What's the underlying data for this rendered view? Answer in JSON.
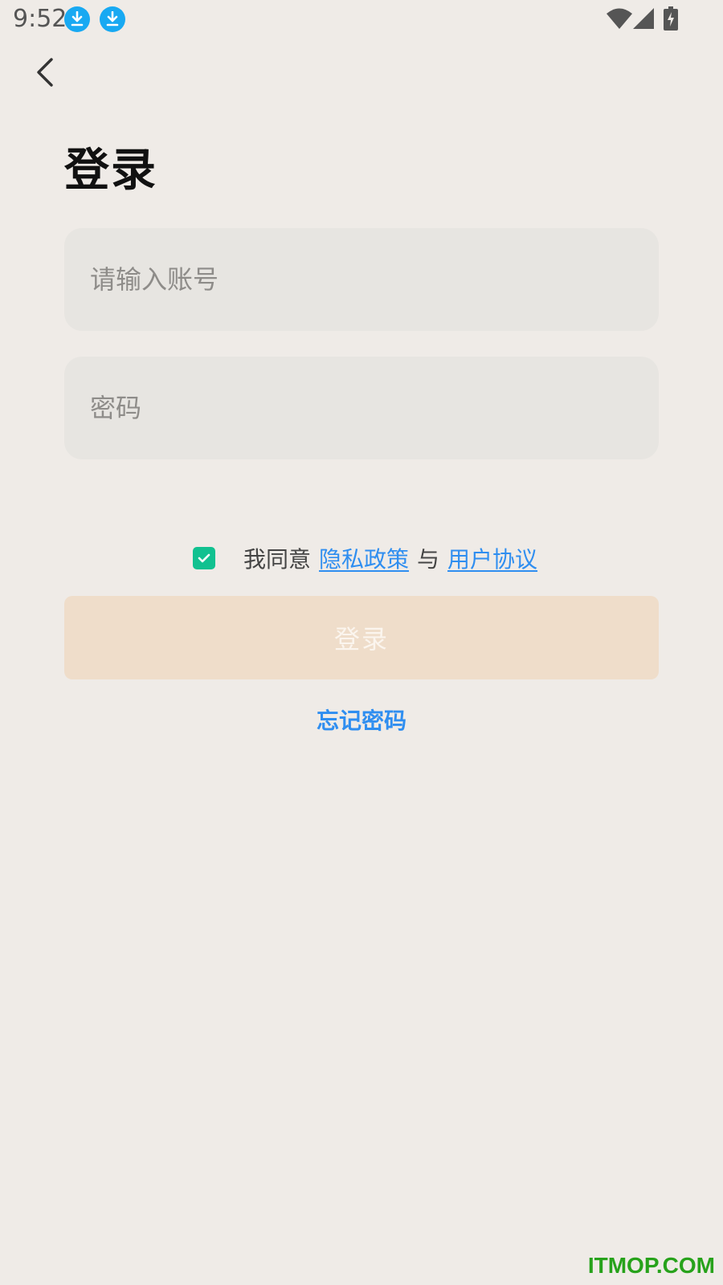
{
  "status_bar": {
    "time": "9:52",
    "icons": [
      "download-notification-icon",
      "download-notification-icon",
      "wifi-icon",
      "cellular-signal-icon",
      "battery-charging-icon"
    ]
  },
  "nav": {
    "back_icon": "chevron-left-icon"
  },
  "page": {
    "title": "登录"
  },
  "form": {
    "account_placeholder": "请输入账号",
    "account_value": "",
    "password_placeholder": "密码",
    "password_value": ""
  },
  "agreement": {
    "checked": true,
    "prefix": "我同意",
    "privacy_link": "隐私政策",
    "and": "与",
    "terms_link": "用户协议"
  },
  "actions": {
    "login_label": "登录",
    "forgot_label": "忘记密码"
  },
  "colors": {
    "background": "#efebe7",
    "accent_link": "#2f8ef0",
    "checkbox": "#11c190",
    "login_button": "#efddca"
  },
  "watermark": "ITMOP.COM"
}
